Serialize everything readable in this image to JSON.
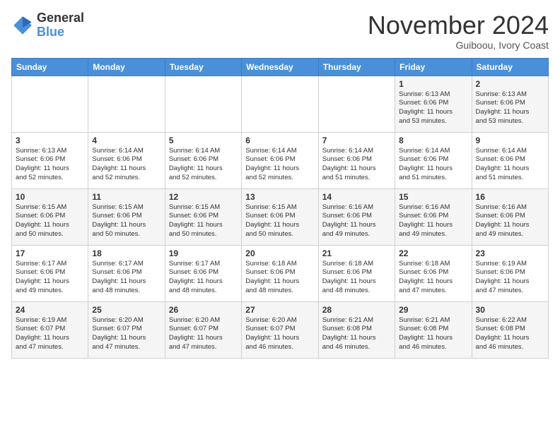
{
  "logo": {
    "general": "General",
    "blue": "Blue"
  },
  "header": {
    "month": "November 2024",
    "location": "Guiboou, Ivory Coast"
  },
  "days_of_week": [
    "Sunday",
    "Monday",
    "Tuesday",
    "Wednesday",
    "Thursday",
    "Friday",
    "Saturday"
  ],
  "weeks": [
    [
      {
        "day": "",
        "info": ""
      },
      {
        "day": "",
        "info": ""
      },
      {
        "day": "",
        "info": ""
      },
      {
        "day": "",
        "info": ""
      },
      {
        "day": "",
        "info": ""
      },
      {
        "day": "1",
        "info": "Sunrise: 6:13 AM\nSunset: 6:06 PM\nDaylight: 11 hours\nand 53 minutes."
      },
      {
        "day": "2",
        "info": "Sunrise: 6:13 AM\nSunset: 6:06 PM\nDaylight: 11 hours\nand 53 minutes."
      }
    ],
    [
      {
        "day": "3",
        "info": "Sunrise: 6:13 AM\nSunset: 6:06 PM\nDaylight: 11 hours\nand 52 minutes."
      },
      {
        "day": "4",
        "info": "Sunrise: 6:14 AM\nSunset: 6:06 PM\nDaylight: 11 hours\nand 52 minutes."
      },
      {
        "day": "5",
        "info": "Sunrise: 6:14 AM\nSunset: 6:06 PM\nDaylight: 11 hours\nand 52 minutes."
      },
      {
        "day": "6",
        "info": "Sunrise: 6:14 AM\nSunset: 6:06 PM\nDaylight: 11 hours\nand 52 minutes."
      },
      {
        "day": "7",
        "info": "Sunrise: 6:14 AM\nSunset: 6:06 PM\nDaylight: 11 hours\nand 51 minutes."
      },
      {
        "day": "8",
        "info": "Sunrise: 6:14 AM\nSunset: 6:06 PM\nDaylight: 11 hours\nand 51 minutes."
      },
      {
        "day": "9",
        "info": "Sunrise: 6:14 AM\nSunset: 6:06 PM\nDaylight: 11 hours\nand 51 minutes."
      }
    ],
    [
      {
        "day": "10",
        "info": "Sunrise: 6:15 AM\nSunset: 6:06 PM\nDaylight: 11 hours\nand 50 minutes."
      },
      {
        "day": "11",
        "info": "Sunrise: 6:15 AM\nSunset: 6:06 PM\nDaylight: 11 hours\nand 50 minutes."
      },
      {
        "day": "12",
        "info": "Sunrise: 6:15 AM\nSunset: 6:06 PM\nDaylight: 11 hours\nand 50 minutes."
      },
      {
        "day": "13",
        "info": "Sunrise: 6:15 AM\nSunset: 6:06 PM\nDaylight: 11 hours\nand 50 minutes."
      },
      {
        "day": "14",
        "info": "Sunrise: 6:16 AM\nSunset: 6:06 PM\nDaylight: 11 hours\nand 49 minutes."
      },
      {
        "day": "15",
        "info": "Sunrise: 6:16 AM\nSunset: 6:06 PM\nDaylight: 11 hours\nand 49 minutes."
      },
      {
        "day": "16",
        "info": "Sunrise: 6:16 AM\nSunset: 6:06 PM\nDaylight: 11 hours\nand 49 minutes."
      }
    ],
    [
      {
        "day": "17",
        "info": "Sunrise: 6:17 AM\nSunset: 6:06 PM\nDaylight: 11 hours\nand 49 minutes."
      },
      {
        "day": "18",
        "info": "Sunrise: 6:17 AM\nSunset: 6:06 PM\nDaylight: 11 hours\nand 48 minutes."
      },
      {
        "day": "19",
        "info": "Sunrise: 6:17 AM\nSunset: 6:06 PM\nDaylight: 11 hours\nand 48 minutes."
      },
      {
        "day": "20",
        "info": "Sunrise: 6:18 AM\nSunset: 6:06 PM\nDaylight: 11 hours\nand 48 minutes."
      },
      {
        "day": "21",
        "info": "Sunrise: 6:18 AM\nSunset: 6:06 PM\nDaylight: 11 hours\nand 48 minutes."
      },
      {
        "day": "22",
        "info": "Sunrise: 6:18 AM\nSunset: 6:06 PM\nDaylight: 11 hours\nand 47 minutes."
      },
      {
        "day": "23",
        "info": "Sunrise: 6:19 AM\nSunset: 6:06 PM\nDaylight: 11 hours\nand 47 minutes."
      }
    ],
    [
      {
        "day": "24",
        "info": "Sunrise: 6:19 AM\nSunset: 6:07 PM\nDaylight: 11 hours\nand 47 minutes."
      },
      {
        "day": "25",
        "info": "Sunrise: 6:20 AM\nSunset: 6:07 PM\nDaylight: 11 hours\nand 47 minutes."
      },
      {
        "day": "26",
        "info": "Sunrise: 6:20 AM\nSunset: 6:07 PM\nDaylight: 11 hours\nand 47 minutes."
      },
      {
        "day": "27",
        "info": "Sunrise: 6:20 AM\nSunset: 6:07 PM\nDaylight: 11 hours\nand 46 minutes."
      },
      {
        "day": "28",
        "info": "Sunrise: 6:21 AM\nSunset: 6:08 PM\nDaylight: 11 hours\nand 46 minutes."
      },
      {
        "day": "29",
        "info": "Sunrise: 6:21 AM\nSunset: 6:08 PM\nDaylight: 11 hours\nand 46 minutes."
      },
      {
        "day": "30",
        "info": "Sunrise: 6:22 AM\nSunset: 6:08 PM\nDaylight: 11 hours\nand 46 minutes."
      }
    ]
  ]
}
